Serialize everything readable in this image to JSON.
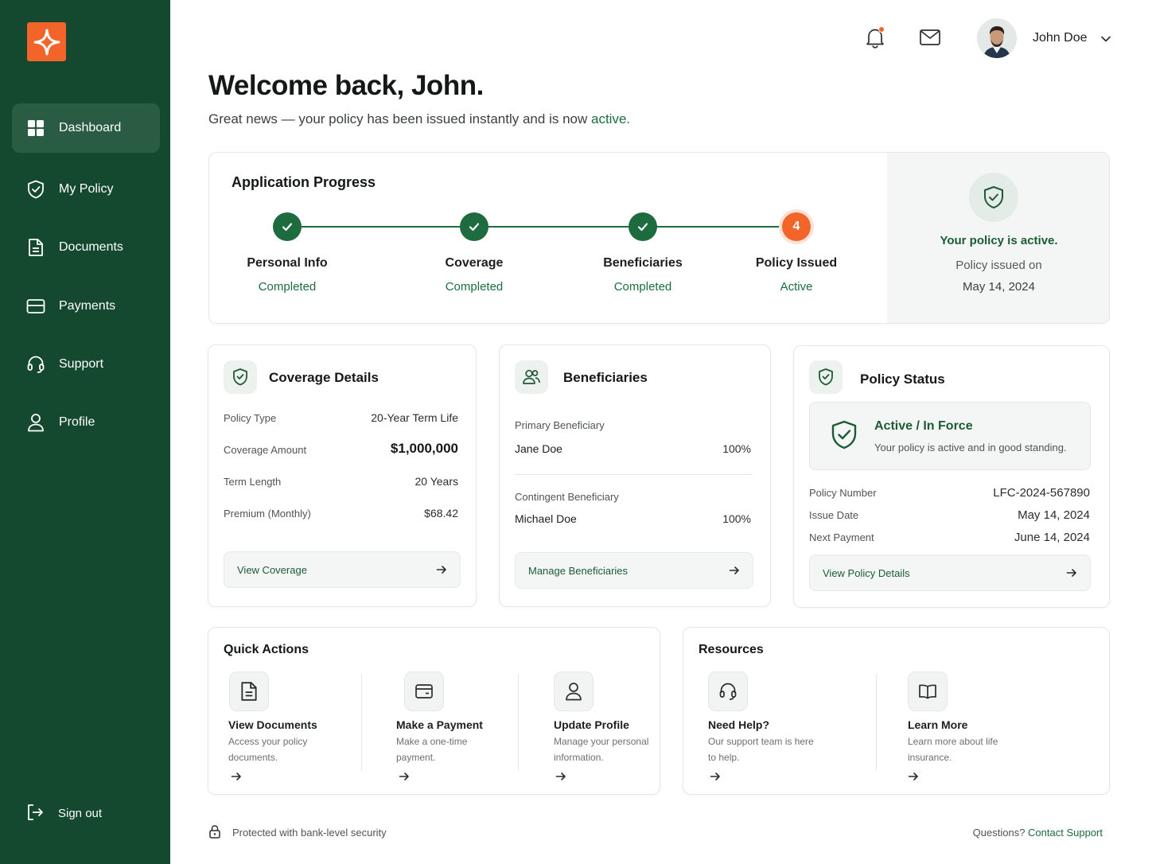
{
  "sidebar": {
    "items": [
      {
        "label": "Dashboard",
        "icon": "grid-icon"
      },
      {
        "label": "My Policy",
        "icon": "shield-icon"
      },
      {
        "label": "Documents",
        "icon": "document-icon"
      },
      {
        "label": "Payments",
        "icon": "credit-card-icon"
      },
      {
        "label": "Support",
        "icon": "headset-icon"
      },
      {
        "label": "Profile",
        "icon": "user-icon"
      }
    ],
    "signout": "Sign out"
  },
  "header": {
    "user_name": "John Doe"
  },
  "welcome": {
    "title": "Welcome back, John.",
    "subtitle_prefix": "Great news — your policy has been issued instantly and is now ",
    "subtitle_highlight": "active."
  },
  "progress": {
    "title": "Application Progress",
    "steps": [
      {
        "label": "Personal Info",
        "status": "Completed"
      },
      {
        "label": "Coverage",
        "status": "Completed"
      },
      {
        "label": "Beneficiaries",
        "status": "Completed"
      },
      {
        "label": "Policy Issued",
        "status": "Active",
        "number": "4"
      }
    ],
    "active_panel": {
      "title": "Your policy is active.",
      "sub": "Policy issued on",
      "date": "May 14, 2024"
    }
  },
  "coverage": {
    "title": "Coverage Details",
    "rows": [
      {
        "label": "Policy Type",
        "value": "20-Year Term Life"
      },
      {
        "label": "Coverage Amount",
        "value": "$1,000,000"
      },
      {
        "label": "Term Length",
        "value": "20 Years"
      },
      {
        "label": "Premium (Monthly)",
        "value": "$68.42"
      }
    ],
    "button": "View Coverage"
  },
  "beneficiaries": {
    "title": "Beneficiaries",
    "primary_label": "Primary Beneficiary",
    "primary_name": "Jane Doe",
    "primary_pct": "100%",
    "contingent_label": "Contingent Beneficiary",
    "contingent_name": "Michael Doe",
    "contingent_pct": "100%",
    "button": "Manage Beneficiaries"
  },
  "policy_status": {
    "title": "Policy Status",
    "status_title": "Active / In Force",
    "status_desc": "Your policy is active and in good standing.",
    "rows": [
      {
        "label": "Policy Number",
        "value": "LFC-2024-567890"
      },
      {
        "label": "Issue Date",
        "value": "May 14, 2024"
      },
      {
        "label": "Next Payment",
        "value": "June 14, 2024"
      }
    ],
    "button": "View Policy Details"
  },
  "quick_actions": {
    "title": "Quick Actions",
    "items": [
      {
        "title": "View Documents",
        "desc": "Access your policy documents.",
        "icon": "document-icon"
      },
      {
        "title": "Make a Payment",
        "desc": "Make a one-time payment.",
        "icon": "wallet-icon"
      },
      {
        "title": "Update Profile",
        "desc": "Manage your personal information.",
        "icon": "user-icon"
      }
    ]
  },
  "resources": {
    "title": "Resources",
    "items": [
      {
        "title": "Need Help?",
        "desc": "Our support team is here to help.",
        "icon": "headset-icon"
      },
      {
        "title": "Learn More",
        "desc": "Learn more about life insurance.",
        "icon": "book-icon"
      }
    ]
  },
  "footer": {
    "security": "Protected with bank-level security",
    "questions": "Questions?",
    "contact": "Contact Support"
  },
  "colors": {
    "sidebar": "#14492f",
    "accent_green": "#1d6b3e",
    "accent_orange": "#f2642a"
  }
}
